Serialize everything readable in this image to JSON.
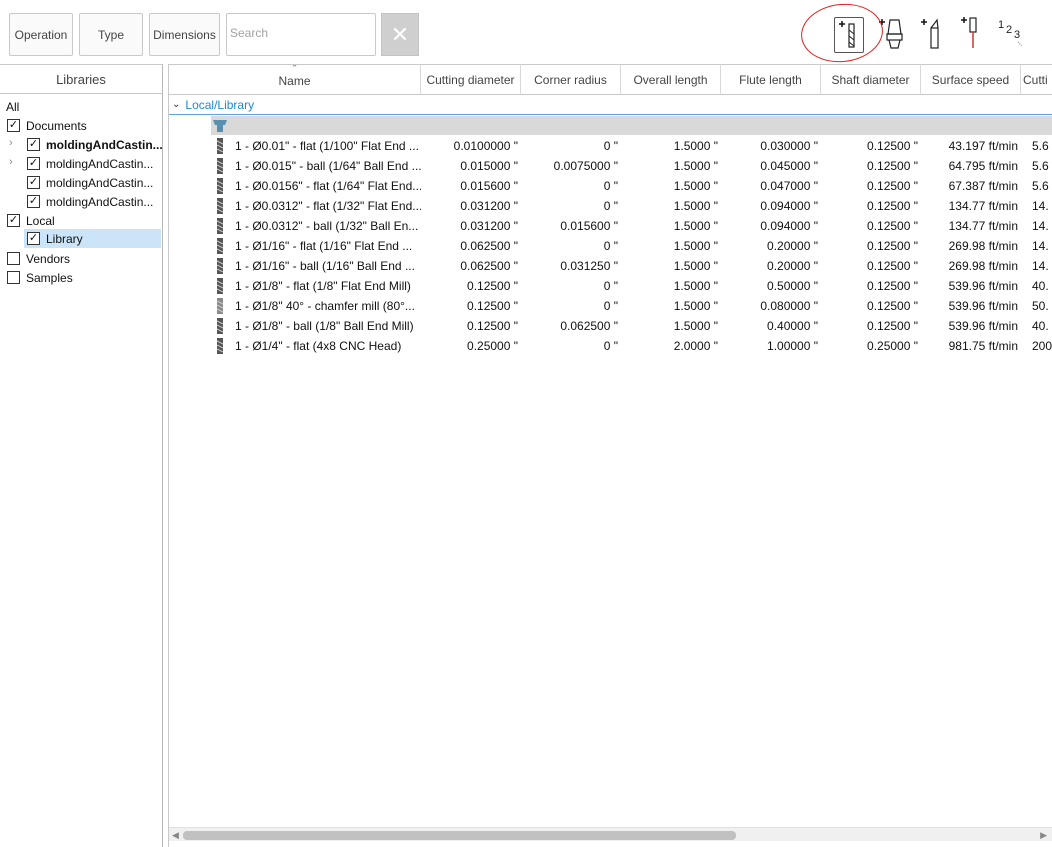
{
  "toolbar": {
    "filters": [
      {
        "label": "Operation"
      },
      {
        "label": "Type"
      },
      {
        "label": "Dimensions"
      }
    ],
    "search_placeholder": "Search",
    "clear_label": "✕",
    "number_icon_text": "1 2 3"
  },
  "libraries": {
    "header": "Libraries",
    "items": [
      {
        "label": "All",
        "checkbox": false,
        "checked": false,
        "bold": false
      },
      {
        "label": "Documents",
        "checkbox": true,
        "checked": true,
        "bold": false
      },
      {
        "label": "moldingAndCastin...",
        "checkbox": true,
        "checked": true,
        "bold": true,
        "expander": true
      },
      {
        "label": "moldingAndCastin...",
        "checkbox": true,
        "checked": true,
        "bold": false,
        "expander": true
      },
      {
        "label": "moldingAndCastin...",
        "checkbox": true,
        "checked": true,
        "bold": false
      },
      {
        "label": "moldingAndCastin...",
        "checkbox": true,
        "checked": true,
        "bold": false
      },
      {
        "label": "Local",
        "checkbox": true,
        "checked": true,
        "bold": false
      },
      {
        "label": "Library",
        "checkbox": true,
        "checked": true,
        "bold": false,
        "selected": true
      },
      {
        "label": "Vendors",
        "checkbox": true,
        "checked": false,
        "bold": false
      },
      {
        "label": "Samples",
        "checkbox": true,
        "checked": false,
        "bold": false
      }
    ]
  },
  "table": {
    "columns": [
      "Name",
      "Cutting diameter",
      "Corner radius",
      "Overall length",
      "Flute length",
      "Shaft diameter",
      "Surface speed",
      "Cutti"
    ],
    "group_label": "Local/Library",
    "rows": [
      {
        "icon": "flat-end-mill-icon",
        "name": "1 - Ø0.01\" - flat (1/100\" Flat End ...",
        "cutting_diameter": "0.0100000 \"",
        "corner_radius": "0 \"",
        "overall_length": "1.5000 \"",
        "flute_length": "0.030000 \"",
        "shaft_diameter": "0.12500 \"",
        "surface_speed": "43.197 ft/min",
        "cutting": "5.6"
      },
      {
        "icon": "ball-end-mill-icon",
        "name": "1 - Ø0.015\" - ball (1/64\" Ball End ...",
        "cutting_diameter": "0.015000 \"",
        "corner_radius": "0.0075000 \"",
        "overall_length": "1.5000 \"",
        "flute_length": "0.045000 \"",
        "shaft_diameter": "0.12500 \"",
        "surface_speed": "64.795 ft/min",
        "cutting": "5.6"
      },
      {
        "icon": "flat-end-mill-icon",
        "name": "1 - Ø0.0156\" - flat (1/64\" Flat End...",
        "cutting_diameter": "0.015600 \"",
        "corner_radius": "0 \"",
        "overall_length": "1.5000 \"",
        "flute_length": "0.047000 \"",
        "shaft_diameter": "0.12500 \"",
        "surface_speed": "67.387 ft/min",
        "cutting": "5.6"
      },
      {
        "icon": "flat-end-mill-icon",
        "name": "1 - Ø0.0312\" - flat (1/32\" Flat End...",
        "cutting_diameter": "0.031200 \"",
        "corner_radius": "0 \"",
        "overall_length": "1.5000 \"",
        "flute_length": "0.094000 \"",
        "shaft_diameter": "0.12500 \"",
        "surface_speed": "134.77 ft/min",
        "cutting": "14."
      },
      {
        "icon": "ball-end-mill-icon",
        "name": "1 - Ø0.0312\" - ball (1/32\" Ball En...",
        "cutting_diameter": "0.031200 \"",
        "corner_radius": "0.015600 \"",
        "overall_length": "1.5000 \"",
        "flute_length": "0.094000 \"",
        "shaft_diameter": "0.12500 \"",
        "surface_speed": "134.77 ft/min",
        "cutting": "14."
      },
      {
        "icon": "flat-end-mill-icon",
        "name": "1 - Ø1/16\" - flat (1/16\" Flat End ...",
        "cutting_diameter": "0.062500 \"",
        "corner_radius": "0 \"",
        "overall_length": "1.5000 \"",
        "flute_length": "0.20000 \"",
        "shaft_diameter": "0.12500 \"",
        "surface_speed": "269.98 ft/min",
        "cutting": "14."
      },
      {
        "icon": "ball-end-mill-icon",
        "name": "1 - Ø1/16\" - ball (1/16\" Ball End ...",
        "cutting_diameter": "0.062500 \"",
        "corner_radius": "0.031250 \"",
        "overall_length": "1.5000 \"",
        "flute_length": "0.20000 \"",
        "shaft_diameter": "0.12500 \"",
        "surface_speed": "269.98 ft/min",
        "cutting": "14."
      },
      {
        "icon": "flat-end-mill-icon",
        "name": "1 - Ø1/8\" - flat (1/8\" Flat End Mill)",
        "cutting_diameter": "0.12500 \"",
        "corner_radius": "0 \"",
        "overall_length": "1.5000 \"",
        "flute_length": "0.50000 \"",
        "shaft_diameter": "0.12500 \"",
        "surface_speed": "539.96 ft/min",
        "cutting": "40."
      },
      {
        "icon": "chamfer-mill-icon",
        "name": "1 - Ø1/8\" 40° - chamfer mill (80°...",
        "cutting_diameter": "0.12500 \"",
        "corner_radius": "0 \"",
        "overall_length": "1.5000 \"",
        "flute_length": "0.080000 \"",
        "shaft_diameter": "0.12500 \"",
        "surface_speed": "539.96 ft/min",
        "cutting": "50."
      },
      {
        "icon": "ball-end-mill-icon",
        "name": "1 - Ø1/8\" - ball (1/8\" Ball End Mill)",
        "cutting_diameter": "0.12500 \"",
        "corner_radius": "0.062500 \"",
        "overall_length": "1.5000 \"",
        "flute_length": "0.40000 \"",
        "shaft_diameter": "0.12500 \"",
        "surface_speed": "539.96 ft/min",
        "cutting": "40."
      },
      {
        "icon": "flat-end-mill-icon",
        "name": "1 - Ø1/4\" - flat (4x8 CNC Head)",
        "cutting_diameter": "0.25000 \"",
        "corner_radius": "0 \"",
        "overall_length": "2.0000 \"",
        "flute_length": "1.00000 \"",
        "shaft_diameter": "0.25000 \"",
        "surface_speed": "981.75 ft/min",
        "cutting": "200"
      }
    ]
  },
  "colors": {
    "accent": "#1f8ad2",
    "selection": "#cce4f7",
    "annotation": "#e02020"
  }
}
